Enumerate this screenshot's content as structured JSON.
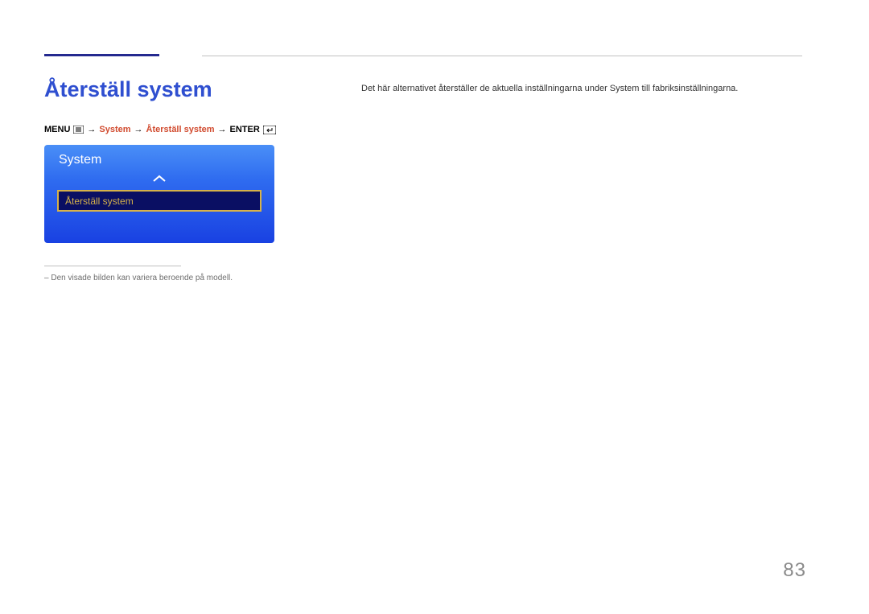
{
  "header": {
    "title": "Återställ system"
  },
  "description": "Det här alternativet återställer de aktuella inställningarna under System till fabriksinställningarna.",
  "breadcrumb": {
    "menu_label": "MENU",
    "system_label": "System",
    "reset_label": "Återställ system",
    "enter_label": "ENTER"
  },
  "menu_panel": {
    "header": "System",
    "selected_item": "Återställ system"
  },
  "footnote": "Den visade bilden kan variera beroende på modell.",
  "page_number": "83",
  "colors": {
    "accent": "#24298f",
    "title": "#2f4fd0",
    "breadcrumb_highlight": "#d14b2f",
    "panel_item_border": "#d6b24a",
    "panel_item_bg": "#0a0f63"
  }
}
